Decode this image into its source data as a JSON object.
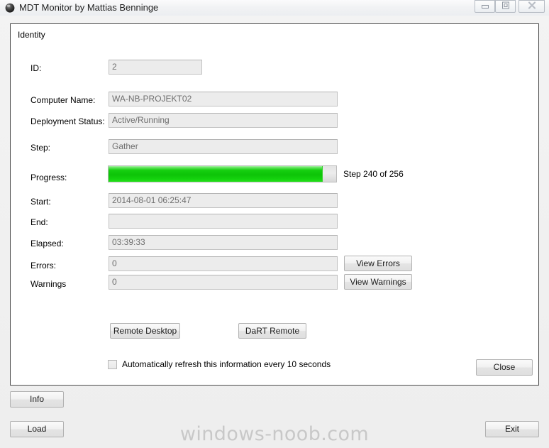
{
  "window": {
    "title": "MDT Monitor by Mattias Benninge",
    "icon": "app-sphere-icon",
    "controls": {
      "minimize_label": "minimize-icon",
      "maximize_label": "restore-icon",
      "close_label": "close-icon"
    }
  },
  "identity_group": {
    "legend": "Identity",
    "fields": [
      {
        "key": "id",
        "label": "ID:",
        "value": "2"
      },
      {
        "key": "computer_name",
        "label": "Computer Name:",
        "value": "WA-NB-PROJEKT02"
      },
      {
        "key": "deployment_status",
        "label": "Deployment Status:",
        "value": "Active/Running"
      },
      {
        "key": "step",
        "label": "Step:",
        "value": "Gather"
      },
      {
        "key": "start",
        "label": "Start:",
        "value": "2014-08-01 06:25:47"
      },
      {
        "key": "end",
        "label": "End:",
        "value": ""
      },
      {
        "key": "elapsed",
        "label": "Elapsed:",
        "value": "03:39:33"
      },
      {
        "key": "errors",
        "label": "Errors:",
        "value": "0"
      },
      {
        "key": "warnings",
        "label": "Warnings",
        "value": "0"
      }
    ],
    "progress": {
      "label": "Progress:",
      "caption": "Step 240 of 256",
      "current": 240,
      "total": 256,
      "percent": 93.75,
      "bar_color": "#0dc408"
    },
    "buttons": {
      "view_errors": "View Errors",
      "view_warnings": "View Warnings",
      "remote_desktop": "Remote Desktop",
      "dart_remote": "DaRT Remote",
      "close": "Close"
    },
    "auto_refresh": {
      "label": "Automatically refresh this information every 10 seconds",
      "checked": false
    }
  },
  "footer": {
    "info_button": "Info",
    "load_button": "Load",
    "exit_button": "Exit"
  },
  "watermark": "windows-noob.com"
}
